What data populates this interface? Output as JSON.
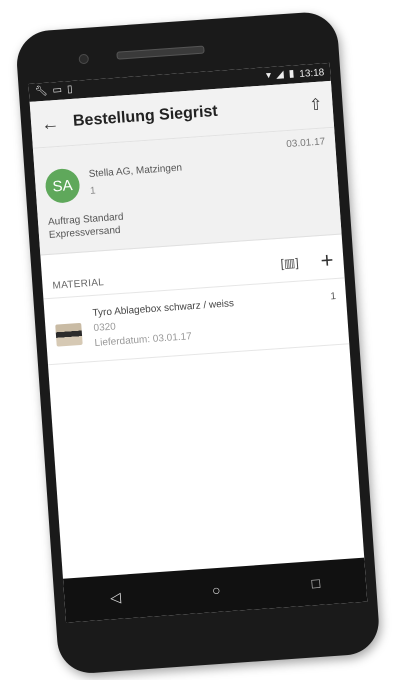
{
  "status_bar": {
    "left_icons": [
      "wrench-icon",
      "screen-icon",
      "sim-icon"
    ],
    "time": "13:18",
    "right_icons": [
      "wifi-icon",
      "signal-icon",
      "battery-icon"
    ]
  },
  "app_bar": {
    "back_icon": "arrow-left-icon",
    "title": "Bestellung Siegrist",
    "upload_icon": "upload-icon"
  },
  "order": {
    "avatar_initials": "SA",
    "avatar_color": "#5fa85b",
    "customer_name": "Stella AG, Matzingen",
    "customer_number": "1",
    "date": "03.01.17",
    "order_type": "Auftrag Standard",
    "shipping": "Expressversand"
  },
  "material": {
    "header_label": "MATERIAL",
    "scan_icon": "barcode-scan-icon",
    "add_icon": "plus-icon",
    "items": [
      {
        "name": "Tyro Ablagebox schwarz / weiss",
        "code": "0320",
        "delivery": "Lieferdatum: 03.01.17",
        "quantity": "1"
      }
    ]
  },
  "nav_bar": {
    "back": "triangle-back-icon",
    "home": "circle-home-icon",
    "recents": "square-recents-icon"
  }
}
